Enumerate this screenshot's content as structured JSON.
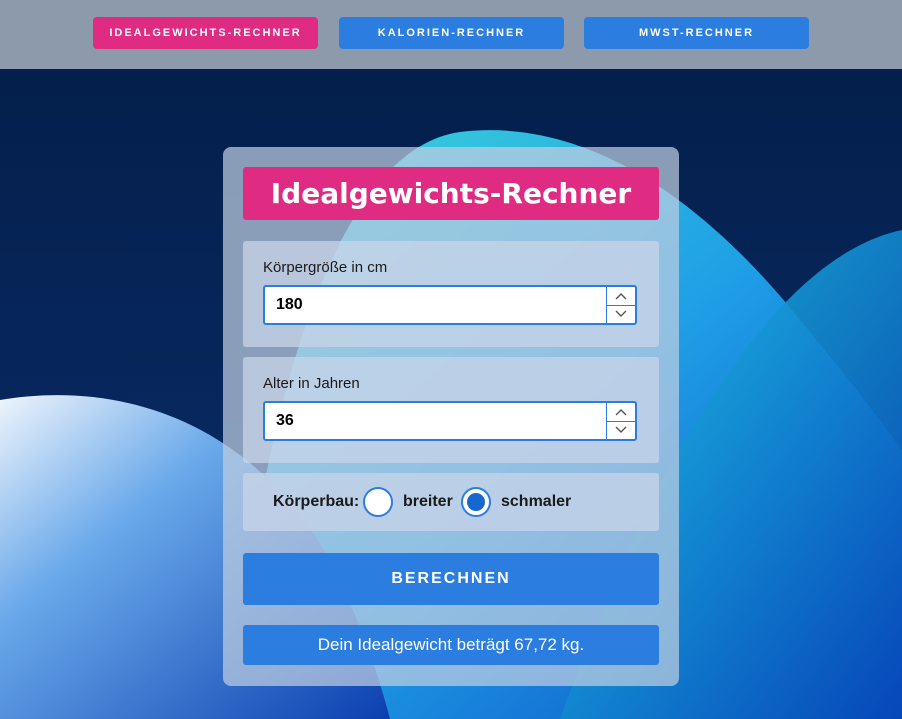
{
  "nav": {
    "items": [
      {
        "label": "IDEALGEWICHTS-RECHNER",
        "active": true
      },
      {
        "label": "KALORIEN-RECHNER",
        "active": false
      },
      {
        "label": "MWST-RECHNER",
        "active": false
      }
    ]
  },
  "calculator": {
    "title": "Idealgewichts-Rechner",
    "height_label": "Körpergröße in cm",
    "height_value": "180",
    "age_label": "Alter in Jahren",
    "age_value": "36",
    "build_label": "Körperbau:",
    "build_options": [
      {
        "label": "breiter",
        "checked": false
      },
      {
        "label": "schmaler",
        "checked": true
      }
    ],
    "submit_label": "BERECHNEN",
    "result_text": "Dein Idealgewicht beträgt 67,72 kg."
  },
  "colors": {
    "accent_pink": "#e02b83",
    "accent_blue": "#2b7de0",
    "nav_bar": "#8c9aab",
    "background_dark": "#06204f"
  },
  "icons": [
    "chevron-up-icon",
    "chevron-down-icon"
  ]
}
